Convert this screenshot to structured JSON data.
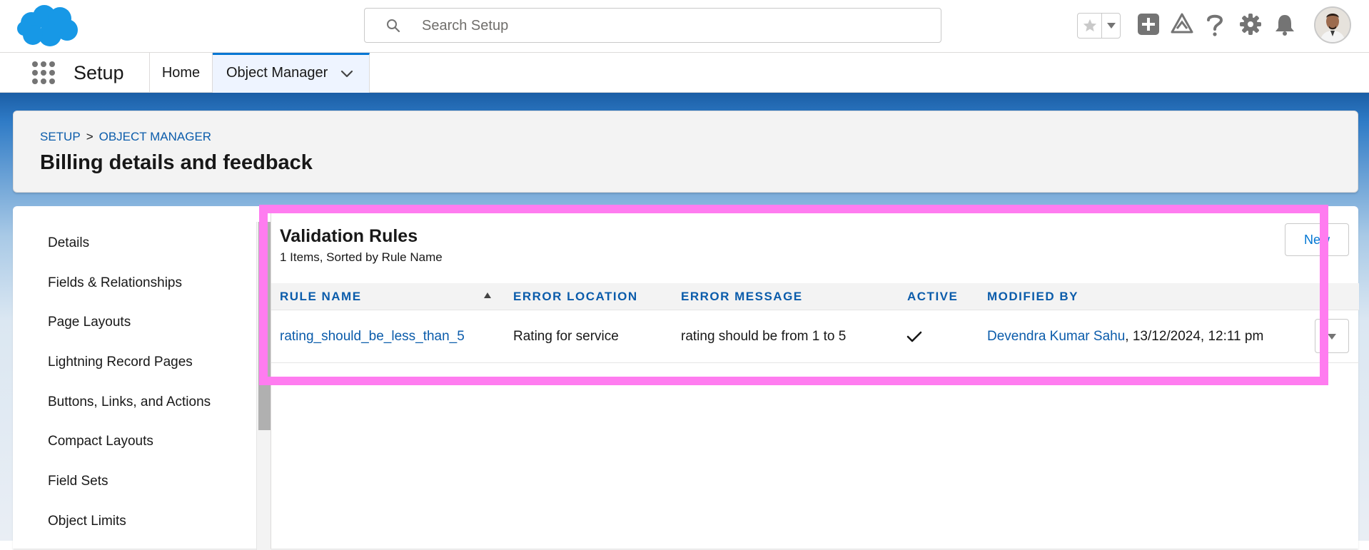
{
  "header": {
    "search_placeholder": "Search Setup",
    "icons": [
      "salesforce-cloud-logo",
      "search-icon",
      "favorites-star-icon",
      "favorites-menu-icon",
      "add-icon",
      "trailhead-icon",
      "help-icon",
      "settings-gear-icon",
      "notifications-bell-icon",
      "user-avatar"
    ]
  },
  "context_bar": {
    "app_name": "Setup",
    "tabs": [
      {
        "label": "Home"
      },
      {
        "label": "Object Manager",
        "active": true
      }
    ]
  },
  "page_header": {
    "breadcrumb": [
      "SETUP",
      "OBJECT MANAGER"
    ],
    "breadcrumb_sep": ">",
    "title": "Billing details and feedback"
  },
  "sidebar": {
    "items": [
      {
        "label": "Details"
      },
      {
        "label": "Fields & Relationships"
      },
      {
        "label": "Page Layouts"
      },
      {
        "label": "Lightning Record Pages"
      },
      {
        "label": "Buttons, Links, and Actions"
      },
      {
        "label": "Compact Layouts"
      },
      {
        "label": "Field Sets"
      },
      {
        "label": "Object Limits"
      }
    ]
  },
  "main": {
    "title": "Validation Rules",
    "subtitle": "1 Items, Sorted by Rule Name",
    "new_button": "New",
    "columns": [
      "RULE NAME",
      "ERROR LOCATION",
      "ERROR MESSAGE",
      "ACTIVE",
      "MODIFIED BY"
    ],
    "rows": [
      {
        "rule_name": "rating_should_be_less_than_5",
        "error_location": "Rating for service",
        "error_message": "rating should be from 1 to 5",
        "active": true,
        "modified_by": "Devendra Kumar Sahu",
        "modified_date": ", 13/12/2024, 12:11 pm"
      }
    ]
  },
  "colors": {
    "brand_blue": "#0176d3",
    "link_blue": "#0b5cab",
    "highlight": "#ff7cf0"
  }
}
